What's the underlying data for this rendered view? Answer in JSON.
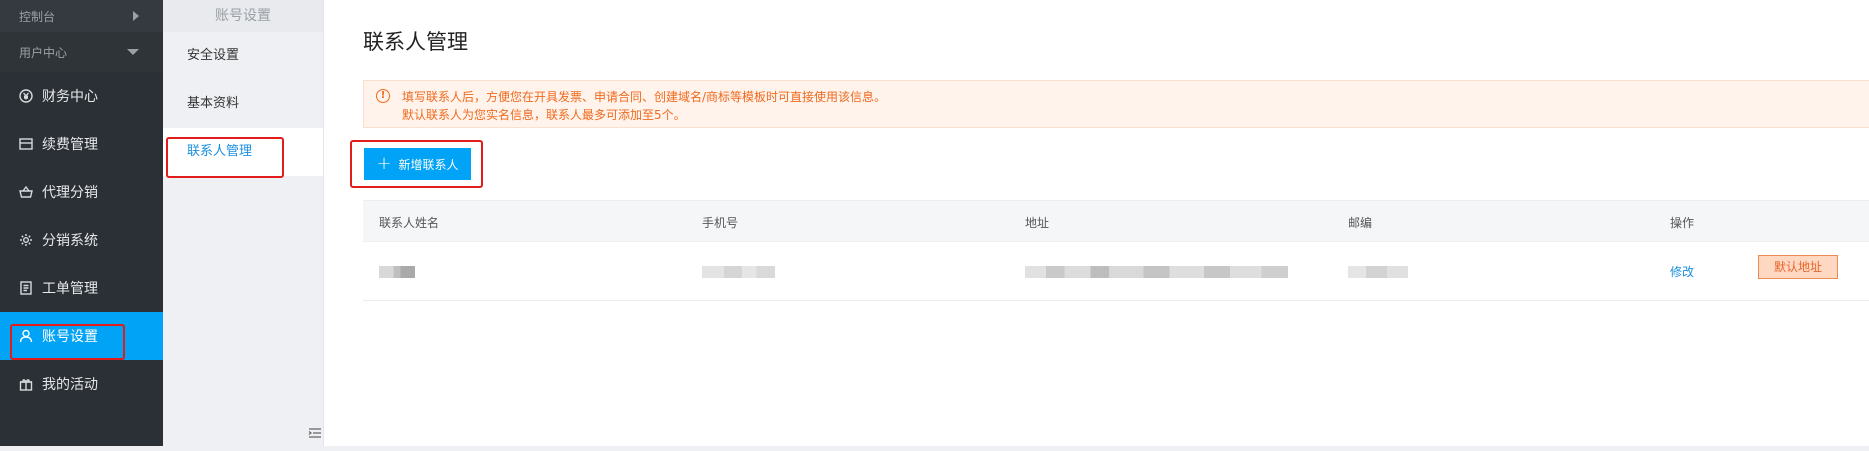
{
  "sidebar": {
    "console_label": "控制台",
    "user_center_label": "用户中心",
    "items": [
      {
        "label": "财务中心",
        "icon": "yen-circle-icon"
      },
      {
        "label": "续费管理",
        "icon": "list-box-icon"
      },
      {
        "label": "代理分销",
        "icon": "basket-icon"
      },
      {
        "label": "分销系统",
        "icon": "gear-icon"
      },
      {
        "label": "工单管理",
        "icon": "document-icon"
      },
      {
        "label": "账号设置",
        "icon": "user-icon",
        "active": true
      },
      {
        "label": "我的活动",
        "icon": "gift-icon"
      }
    ]
  },
  "subnav": {
    "heading": "账号设置",
    "items": [
      {
        "label": "安全设置"
      },
      {
        "label": "基本资料"
      },
      {
        "label": "联系人管理",
        "active": true
      }
    ]
  },
  "main": {
    "title": "联系人管理",
    "notice": {
      "line1": "填写联系人后，方便您在开具发票、申请合同、创建域名/商标等模板时可直接使用该信息。",
      "line2": "默认联系人为您实名信息，联系人最多可添加至5个。"
    },
    "add_button_label": "新增联系人",
    "table": {
      "columns": [
        "联系人姓名",
        "手机号",
        "地址",
        "邮编",
        "操作"
      ],
      "row": {
        "edit_label": "修改",
        "default_label": "默认地址"
      }
    }
  },
  "colors": {
    "accent": "#00a3f5",
    "sidebar_bg": "#2b3036",
    "notice_text": "#ef6a1f",
    "highlight_box": "#e21b1b"
  }
}
